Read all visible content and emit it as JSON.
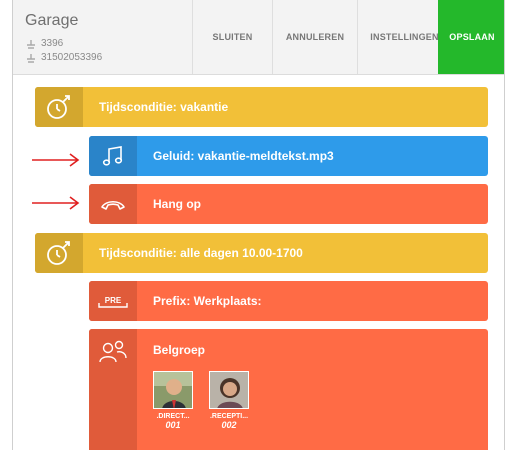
{
  "header": {
    "title": "Garage",
    "numbers": [
      "3396",
      "31502053396"
    ],
    "buttons": {
      "close": "SLUITEN",
      "cancel": "ANNULEREN",
      "settings": "INSTELLINGEN",
      "save": "OPSLAAN"
    }
  },
  "rows": [
    {
      "label": "Tijdsconditie: vakantie",
      "icon": "clock-icon",
      "color": "#f2c038"
    },
    {
      "label": "Geluid: vakantie-meldtekst.mp3",
      "icon": "music-note-icon",
      "color": "#2e9bea"
    },
    {
      "label": "Hang op",
      "icon": "hang-up-phone-icon",
      "color": "#ff6b45"
    },
    {
      "label": "Tijdsconditie: alle dagen 10.00-1700",
      "icon": "clock-icon",
      "color": "#f2c038"
    },
    {
      "label": "Prefix: Werkplaats:",
      "icon": "prefix-icon",
      "icon_text": "PRE",
      "color": "#ff6b45"
    },
    {
      "label": "Belgroep",
      "icon": "group-icon",
      "color": "#ff6b45"
    }
  ],
  "group_members": [
    {
      "name": ".DIRECT...",
      "ext": "001"
    },
    {
      "name": ".RECEPTI...",
      "ext": "002"
    }
  ]
}
